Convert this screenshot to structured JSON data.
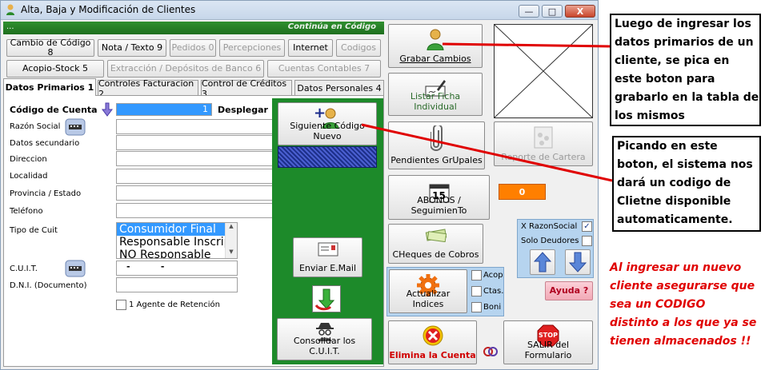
{
  "window": {
    "title": "Alta, Baja y Modificación de Clientes",
    "minimize": "—",
    "maximize": "□",
    "close": "X"
  },
  "greenbar": {
    "dots": "...",
    "continua": "Continúa en Código"
  },
  "toolbar_row1": [
    {
      "label": "Cambio de Código 8",
      "disabled": false
    },
    {
      "label": "Nota / Texto 9",
      "disabled": false
    },
    {
      "label": "Pedidos 0",
      "disabled": true
    },
    {
      "label": "Percepciones",
      "disabled": true
    },
    {
      "label": "Internet",
      "disabled": false
    },
    {
      "label": "Codigos",
      "disabled": true
    }
  ],
  "toolbar_row2": [
    {
      "label": "Acopio-Stock 5",
      "disabled": false
    },
    {
      "label": "Extracción / Depósitos de Banco 6",
      "disabled": true
    },
    {
      "label": "Cuentas Contables 7",
      "disabled": true
    }
  ],
  "tabs": [
    "Datos Primarios 1",
    "Controles Facturacion 2",
    "Control de Créditos 3",
    "Datos Personales 4"
  ],
  "form": {
    "codigo_label": "Código de Cuenta",
    "codigo_value": "1",
    "desplegar": "Desplegar",
    "razon_social": "Razón Social",
    "datos_secundario": "Datos secundario",
    "direccion": "Direccion",
    "localidad": "Localidad",
    "provincia": "Provincia / Estado",
    "telefono": "Teléfono",
    "tipo_cuit": "Tipo de Cuit",
    "tipo_options": [
      "Consumidor Final",
      "Responsable Inscrip",
      "NO Responsable"
    ],
    "cuit_label": "C.U.I.T.",
    "cuit_value": "-          -",
    "dni_label": "D.N.I. (Documento)",
    "agente": "1 Agente de Retención"
  },
  "green_buttons": {
    "siguiente": "Siguiente Código Nuevo",
    "enviar": "Enviar E.Mail",
    "consolidar": "Consolidar los C.U.I.T."
  },
  "right_buttons": {
    "grabar": "Grabar Cambios",
    "listar": "Listar Ficha Individual",
    "pendientes": "Pendientes GrUpales",
    "reporte": "Reporte de Cartera",
    "abonos": "ABONOS / SeguimienTo",
    "abonos_calendar": "15",
    "counter": "0",
    "cheques": "CHeques de Cobros",
    "actualizar": "Actualizar Indices",
    "acop": "Acop",
    "ctas": "Ctas.",
    "boni": "Boni",
    "x_razon": "X RazonSocial",
    "solo_deudores": "Solo Deudores",
    "ayuda": "Ayuda ?",
    "elimina": "Elimina la Cuenta",
    "salir": "SALIR del Formulario",
    "stop": "STOP"
  },
  "annotations": {
    "grabar_note": [
      "Luego de ingresar los",
      "datos primarios de un",
      "cliente, se pica en",
      "este boton para",
      "grabarlo en la tabla de",
      "los mismos"
    ],
    "siguiente_note": [
      "Picando en este",
      "boton, el sistema nos",
      "dará un codigo de",
      "Clietne disponible",
      "automaticamente."
    ],
    "warning": [
      "Al ingresar un nuevo",
      "cliente asegurarse que",
      "sea un CODIGO",
      "distinto a los que ya se",
      "tienen almacenados !!"
    ]
  },
  "colors": {
    "green": "#1d8a2a",
    "annotation_red": "#e00000",
    "orange": "#ff7f00",
    "selection": "#3399ff"
  }
}
